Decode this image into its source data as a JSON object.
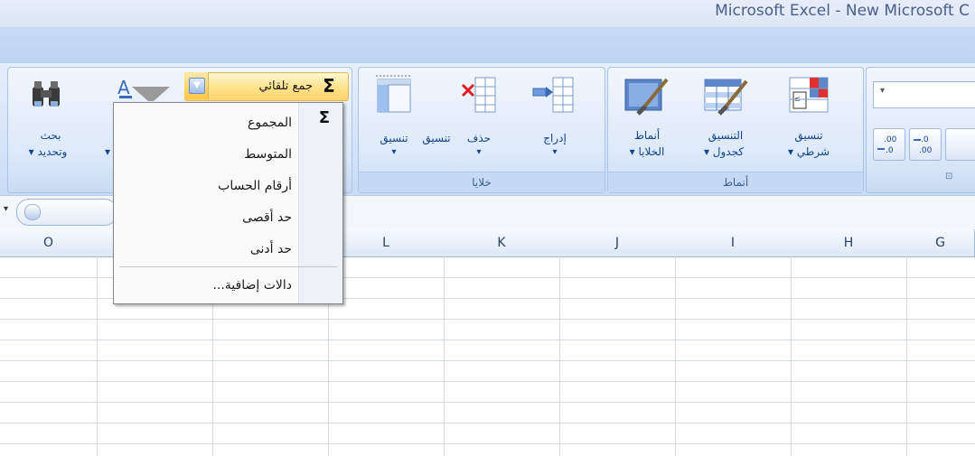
{
  "window": {
    "title": "Microsoft Excel - New Microsoft C"
  },
  "ribbon": {
    "editing": {
      "autosum_label": "جمع تلقائي",
      "autosum_symbol": "Σ",
      "find_select_label_1": "بحث",
      "find_select_label_2": "وتحديد ▾",
      "sort_filter_label_tail": "▾"
    },
    "cells": {
      "group_label": "خلايا",
      "format_label": "تنسيق",
      "delete_label": "حذف",
      "insert_label": "إدراج",
      "arrow": "▾"
    },
    "styles": {
      "group_label": "أنماط",
      "cell_styles_1": "أنماط",
      "cell_styles_2": "الخلايا ▾",
      "format_table_1": "التنسيق",
      "format_table_2": "كجدول ▾",
      "conditional_1": "تنسيق",
      "conditional_2": "شرطي ▾"
    },
    "number": {
      "decimal_increase": ".00→.0",
      "decimal_decrease": ".0→.00",
      "dropdown_arrow": "▾",
      "launcher_icon": "⊡"
    }
  },
  "autosum_menu": {
    "sigma": "Σ",
    "items": [
      {
        "label": "المجموع"
      },
      {
        "label": "المتوسط"
      },
      {
        "label": "أرقام الحساب"
      },
      {
        "label": "حد أقصى"
      },
      {
        "label": "حد أدنى"
      }
    ],
    "more": "دالات إضافية..."
  },
  "grid": {
    "columns": [
      "O",
      "",
      "",
      "L",
      "K",
      "J",
      "I",
      "H",
      "G"
    ]
  },
  "formula_bar": {
    "name_box_arrow": "▾"
  }
}
